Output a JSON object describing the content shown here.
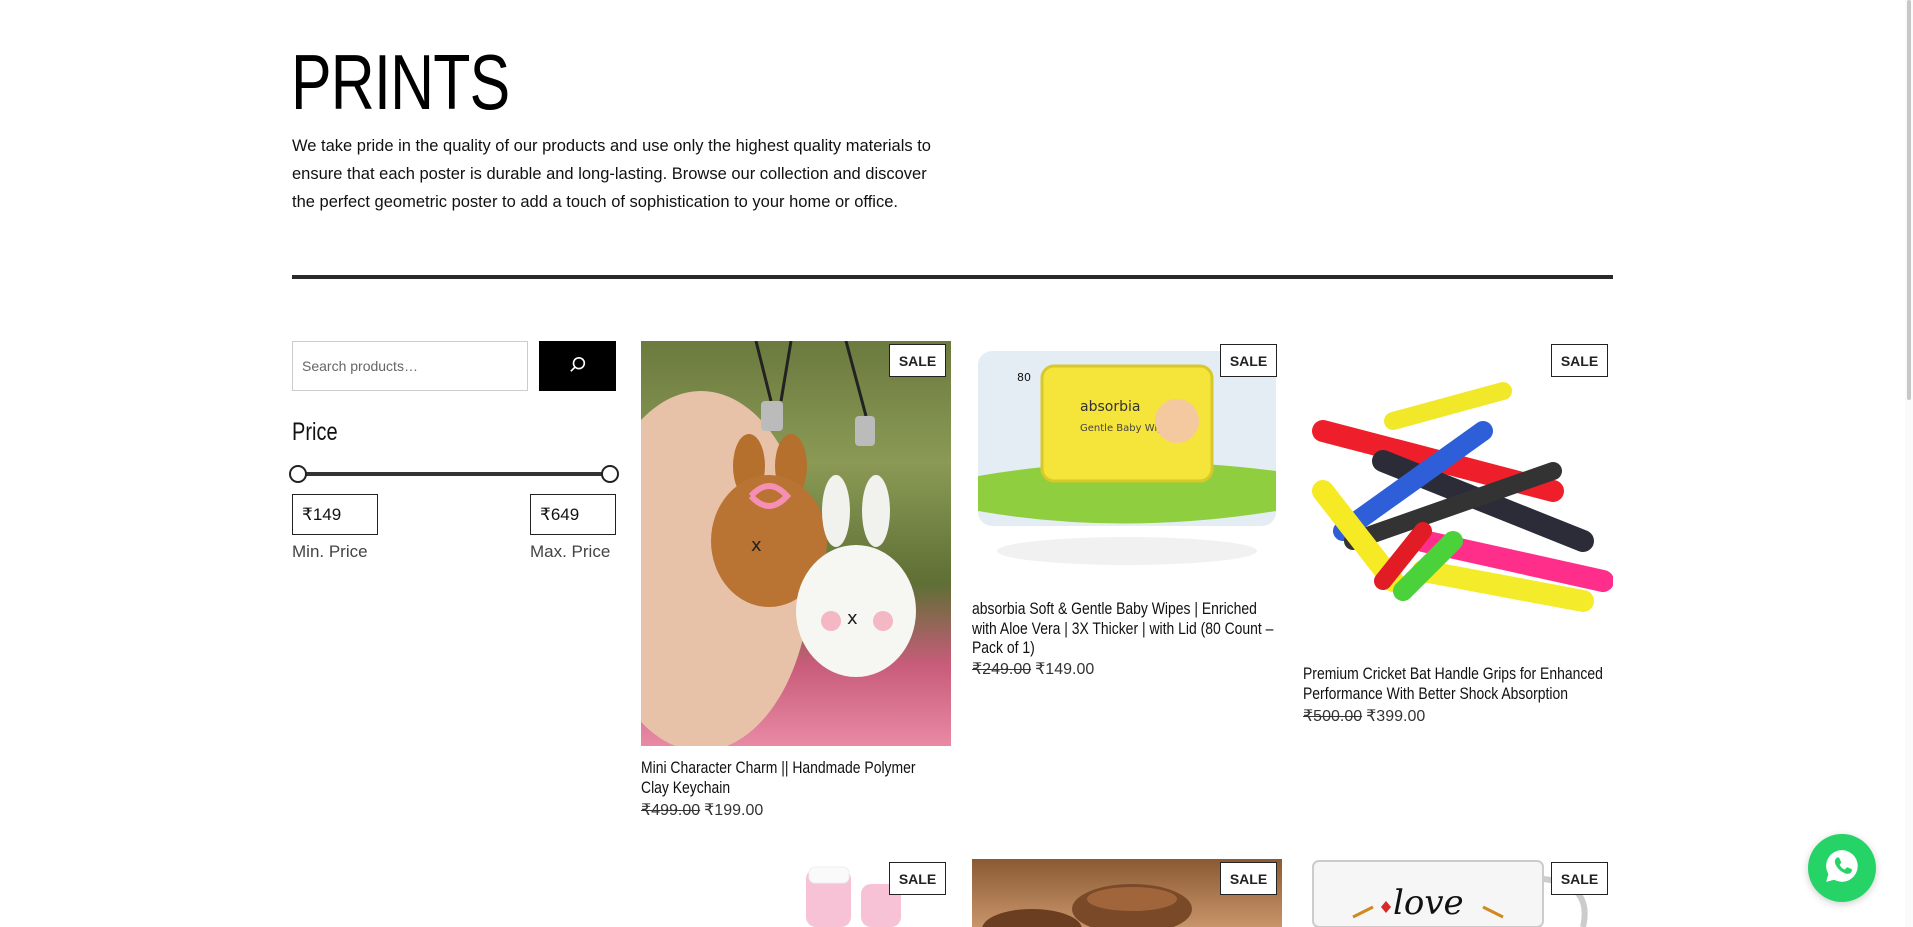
{
  "page": {
    "title": "PRINTS",
    "description": "We take pride in the quality of our products and use only the highest quality materials to ensure that each poster is durable and long-lasting. Browse our collection and discover the perfect geometric poster to add a touch of sophistication to your home or office."
  },
  "sidebar": {
    "search_placeholder": "Search products…",
    "search_icon": "search-icon",
    "price_heading": "Price",
    "min_price": "₹149",
    "max_price": "₹649",
    "min_label": "Min. Price",
    "max_label": "Max. Price"
  },
  "products": [
    {
      "badge": "SALE",
      "title": "Mini Character Charm || Handmade Polymer Clay Keychain",
      "old_price": "₹499.00",
      "price": "₹199.00"
    },
    {
      "badge": "SALE",
      "title": "absorbia Soft & Gentle Baby Wipes | Enriched with Aloe Vera | 3X Thicker | with Lid (80 Count – Pack of 1)",
      "old_price": "₹249.00",
      "price": "₹149.00"
    },
    {
      "badge": "SALE",
      "title": "Premium Cricket Bat Handle Grips for Enhanced Performance With Better Shock Absorption",
      "old_price": "₹500.00",
      "price": "₹399.00"
    },
    {
      "badge": "SALE"
    },
    {
      "badge": "SALE"
    },
    {
      "badge": "SALE"
    }
  ],
  "wipes_pack": {
    "count": "80",
    "brand": "absorbia",
    "line": "Gentle Baby Wipes"
  },
  "mug_text": "love",
  "whatsapp_icon": "whatsapp-icon",
  "colors": {
    "accent": "#000000",
    "whatsapp": "#25d366",
    "divider": "#2a2a2a"
  }
}
